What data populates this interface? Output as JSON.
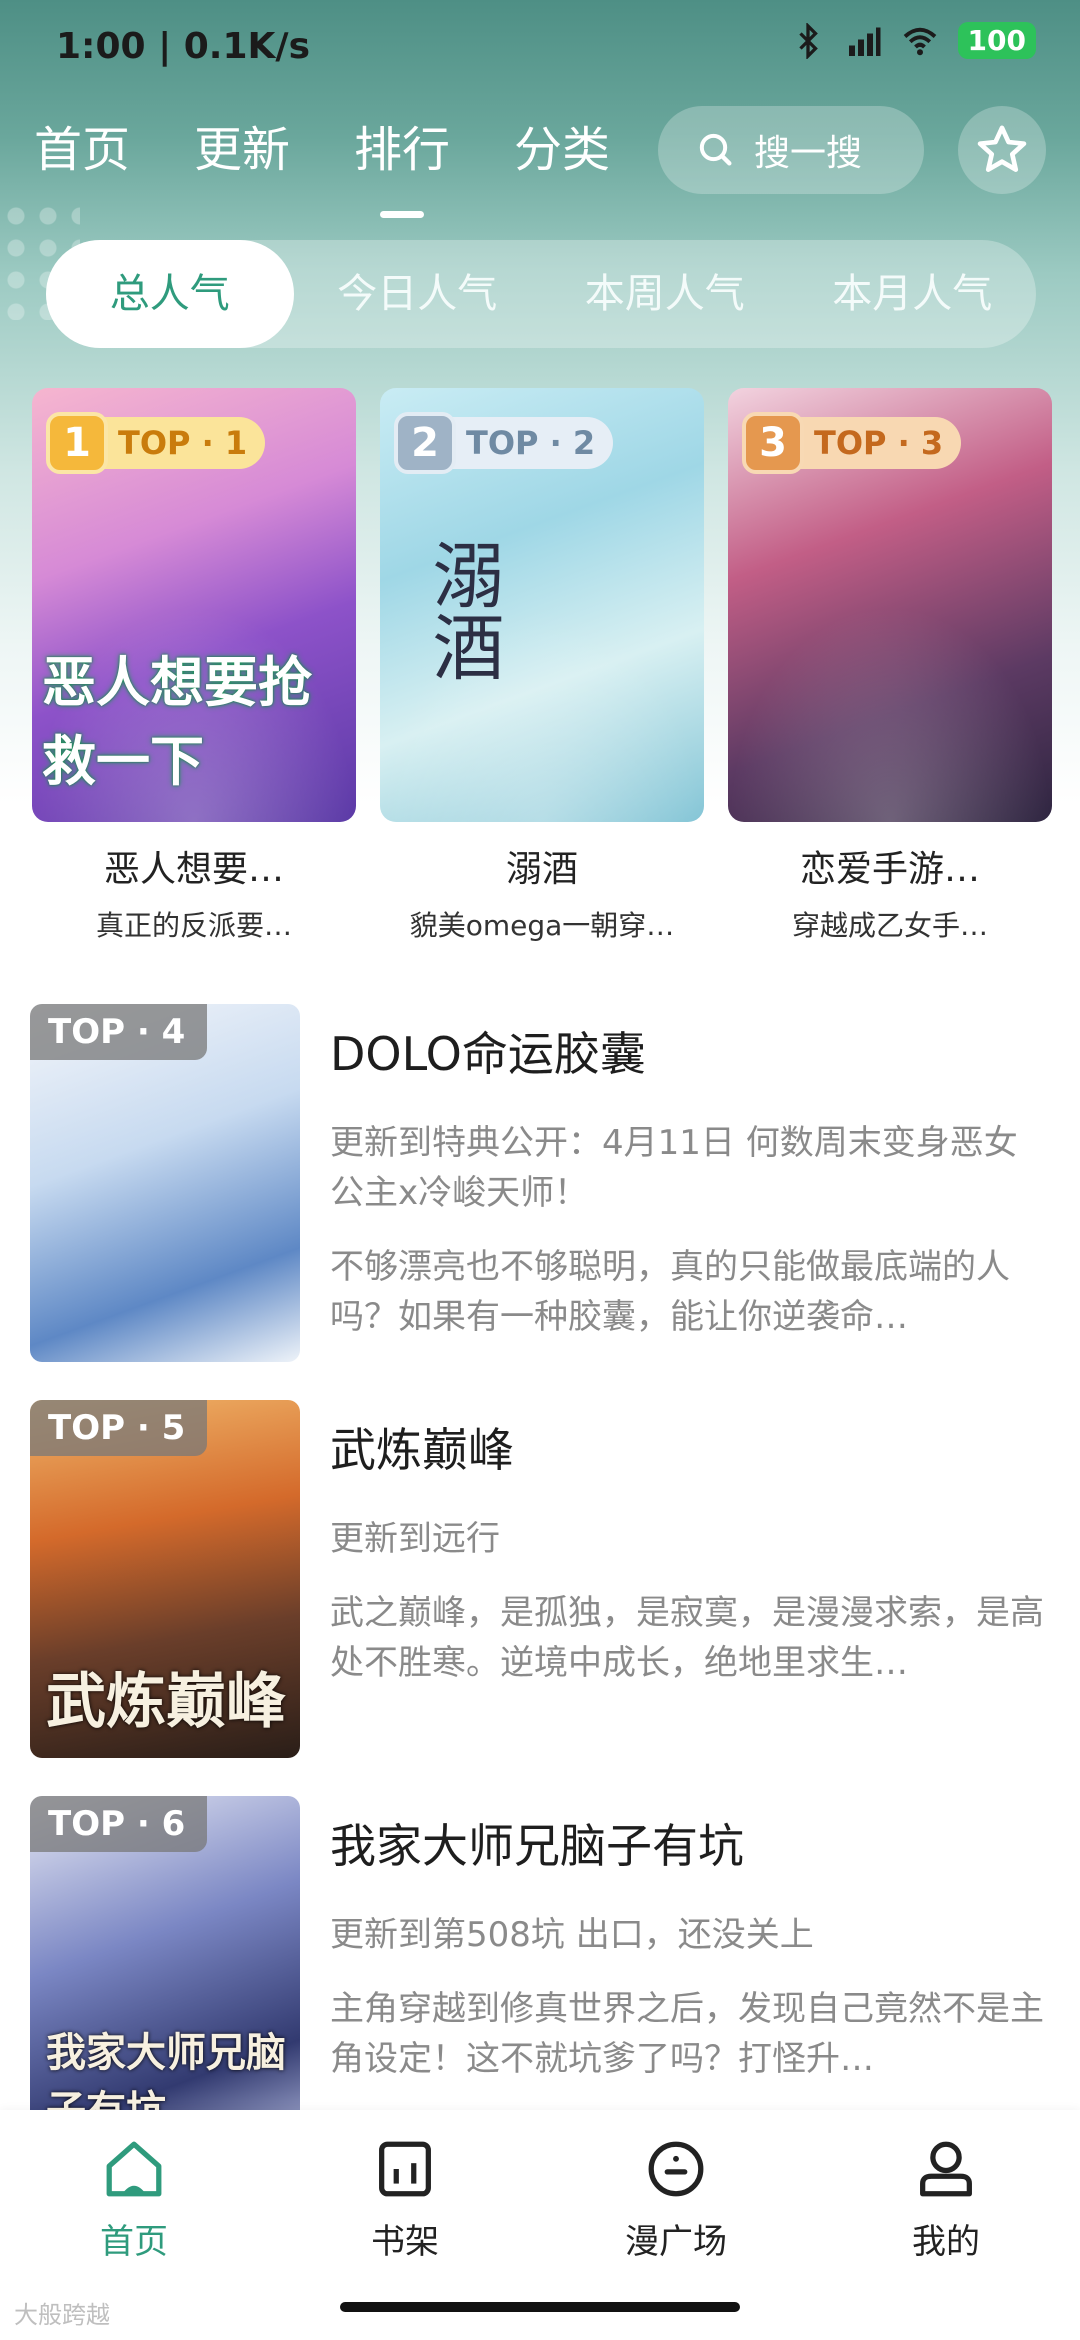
{
  "status_bar": {
    "time_speed": "1:00 | 0.1K/s",
    "battery": "100"
  },
  "top_nav": {
    "tabs": [
      {
        "label": "首页"
      },
      {
        "label": "更新"
      },
      {
        "label": "排行"
      },
      {
        "label": "分类"
      }
    ],
    "active_tab": "排行",
    "search_placeholder": "搜一搜"
  },
  "filter_tabs": [
    "总人气",
    "今日人气",
    "本周人气",
    "本月人气"
  ],
  "active_filter": "总人气",
  "top3": [
    {
      "rank_num": "1",
      "rank_label": "TOP · 1",
      "title": "恶人想要…",
      "subtitle": "真正的反派要…",
      "cover_text": "恶人想要抢救一下"
    },
    {
      "rank_num": "2",
      "rank_label": "TOP · 2",
      "title": "溺酒",
      "subtitle": "貌美omega一朝穿…",
      "cover_text": "溺酒"
    },
    {
      "rank_num": "3",
      "rank_label": "TOP · 3",
      "title": "恋爱手游…",
      "subtitle": "穿越成乙女手…",
      "cover_text": ""
    }
  ],
  "ranking_list": [
    {
      "rank_label": "TOP · 4",
      "title": "DOLO命运胶囊",
      "update": "更新到特典公开：4月11日 何数周末变身恶女公主x冷峻天师！",
      "desc": "不够漂亮也不够聪明，真的只能做最底端的人吗？如果有一种胶囊，能让你逆袭命…",
      "cover_text": ""
    },
    {
      "rank_label": "TOP · 5",
      "title": "武炼巅峰",
      "update": "更新到远行",
      "desc": "武之巅峰，是孤独，是寂寞，是漫漫求索，是高处不胜寒。逆境中成长，绝地里求生…",
      "cover_text": "武炼巅峰"
    },
    {
      "rank_label": "TOP · 6",
      "title": "我家大师兄脑子有坑",
      "update": "更新到第508坑 出口，还没关上",
      "desc": "主角穿越到修真世界之后，发现自己竟然不是主角设定！这不就坑爹了吗？打怪升…",
      "cover_text": "我家大师兄脑子有坑"
    }
  ],
  "bottom_nav": [
    {
      "label": "首页",
      "icon": "home-icon"
    },
    {
      "label": "书架",
      "icon": "bookshelf-icon"
    },
    {
      "label": "漫广场",
      "icon": "plaza-icon"
    },
    {
      "label": "我的",
      "icon": "profile-icon"
    }
  ],
  "active_bottom": "首页",
  "watermark": "大般跨越",
  "colors": {
    "accent": "#2f9b7d",
    "header_green": "#4e8f85",
    "battery_green": "#2dc25a"
  }
}
